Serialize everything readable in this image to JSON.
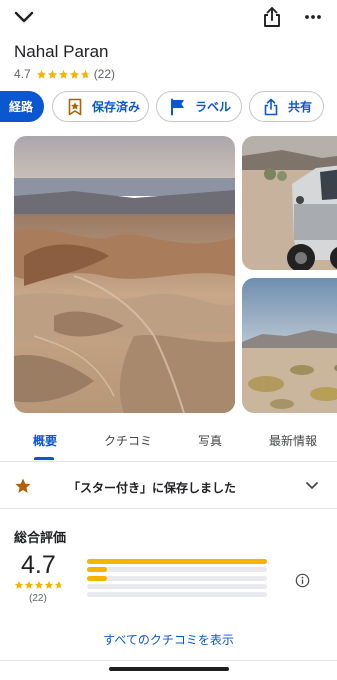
{
  "header": {
    "back_icon": "chevron-down-icon",
    "share_icon": "share-icon",
    "more_icon": "more-horizontal-icon"
  },
  "place": {
    "name": "Nahal Paran",
    "rating": "4.7",
    "review_count": "(22)",
    "stars": 4.7
  },
  "actions": {
    "directions": "経路",
    "saved": "保存済み",
    "label": "ラベル",
    "share": "共有"
  },
  "tabs": [
    {
      "label": "概要",
      "active": true
    },
    {
      "label": "クチコミ",
      "active": false
    },
    {
      "label": "写真",
      "active": false
    },
    {
      "label": "最新情報",
      "active": false
    }
  ],
  "saved_notice": "「スター付き」に保存しました",
  "ratings": {
    "section_title": "総合評価",
    "average": "4.7",
    "count": "(22)",
    "distribution": [
      {
        "stars": 5,
        "fraction": 1.0
      },
      {
        "stars": 4,
        "fraction": 0.11
      },
      {
        "stars": 3,
        "fraction": 0.11
      },
      {
        "stars": 2,
        "fraction": 0.0
      },
      {
        "stars": 1,
        "fraction": 0.0
      }
    ]
  },
  "see_all_reviews": "すべてのクチコミを表示",
  "colors": {
    "accent": "#0b57d0",
    "star": "#f4b400",
    "saved_star": "#b06000"
  }
}
